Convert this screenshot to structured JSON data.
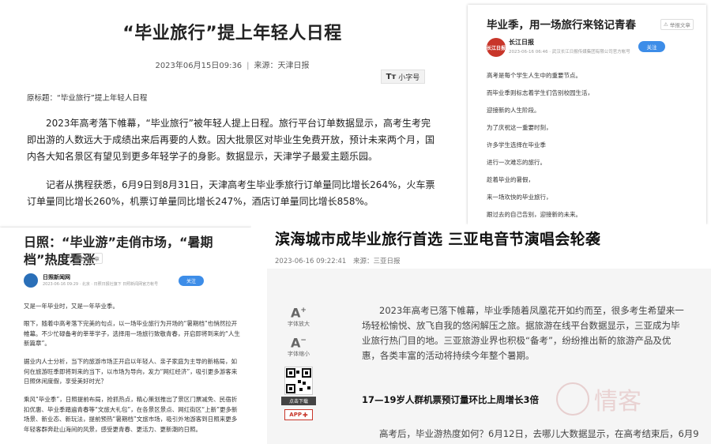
{
  "panel_a": {
    "title": "“毕业旅行”提上年轻人日程",
    "date": "2023年06月15日09:36",
    "separator": "|",
    "source": "来源：天津日报",
    "small_font_icon": "Tт",
    "small_font_label": "小字号",
    "original_title": "原标题：“毕业旅行”提上年轻人日程",
    "paragraphs": [
      "2023年高考落下帷幕，“毕业旅行”被年轻人提上日程。旅行平台订单数据显示，高考生考完即出游的人数远大于成绩出来后再要的人数。因大批景区对毕业生免费开放，预计未来两个月，国内各大知名景区有望见到更多年轻学子的身影。数据显示，天津学子最爱主题乐园。",
      "记者从携程获悉，6月9日到8月31日，天津高考生毕业季旅行订单量同比增长264%，火车票订单量同比增长260%，机票订单量同比增长247%，酒店订单量同比增长858%。"
    ]
  },
  "panel_b": {
    "title": "毕业季，用一场旅行来铭记青春",
    "report": "举报文章",
    "avatar_text": "长江日报",
    "source": "长江日报",
    "source_meta": "2023-06-16 06:46 · 武汉长江日报传媒集团有限公司官方帐号",
    "follow": "关注",
    "lines": [
      "高考是每个学生人生中的重要节点。",
      "而毕业季则标志着学生们告别校园生活，",
      "迎接新的人生阶段。",
      "为了庆祝这一重要时刻，",
      "许多学生选择在毕业季",
      "进行一次难忘的旅行。",
      "趁着毕业的暑假，",
      "来一场欢快的毕业旅行，",
      "跟过去的自己告别，迎接新的未来。"
    ]
  },
  "panel_c": {
    "title": "日照：“毕业游”走俏市场，“暑期档”热度看涨",
    "report": "举报文章",
    "source": "日照新闻网",
    "source_meta": "2023-06-16 09:29 · 北京 · 日照日报社旗下 日照新闻网官方帐号",
    "follow": "关注",
    "paragraphs": [
      "又是一年毕业时，又是一年毕业季。",
      "眼下，随着中高考落下完美的句点，以一场毕业旅行为开场的“暑期档”也悄然拉开帷幕。不少忙碌备考的莘莘学子，选择用一场旅行致敬青春，开启即将到来的“人生新篇章”。",
      "据业内人士分析，当下的旅游市场正开启以年轻人、亲子家庭为主导的新格局，如何在旅游旺季即将到来的当下，以市场为导向，发力“网红经济”，吸引更多游客来日照休闲度假，享受美好时光？",
      "乘风“毕业季”，日照提前布局，抢抓热点，精心策划推出了景区门票减免、民宿折扣优惠、毕业季踏遍青春等“文旅大礼包”，在各景区景点、网红街区“上新”更多新场景、新业态、新玩法，提前预热“暑期档”文旅市场，吸引外地游客到日照来更多年轻客群奔赴山海间的风景，感受更青春、更活力、更新潮的日照。"
    ]
  },
  "panel_d": {
    "title": "滨海城市成毕业旅行首选 三亚电音节演唱会轮袭",
    "date": "2023-06-16 09:22:41",
    "source": "来源：三亚日报",
    "font_larger_label": "字体放大",
    "font_smaller_label": "字体缩小",
    "download_label": "点击下载",
    "app_label": "APP",
    "paragraphs": [
      "2023年高考已落下帷幕，毕业季随着凤凰花开如约而至，很多考生希望来一场轻松愉悦、放飞自我的悠闲解压之旅。据旅游在线平台数据显示，三亚成为毕业旅行热门目的地。三亚旅游业界也积极“备考”，纷纷推出新的旅游产品及优惠，各类丰富的活动将持续今年整个暑期。"
    ],
    "subhead": "17—19岁人群机票预订量环比上周增长3倍",
    "last_line": "高考后，毕业游热度如何？6月12日，去哪儿大数据显示，在高考结束后，6月9",
    "watermark": "情客"
  }
}
